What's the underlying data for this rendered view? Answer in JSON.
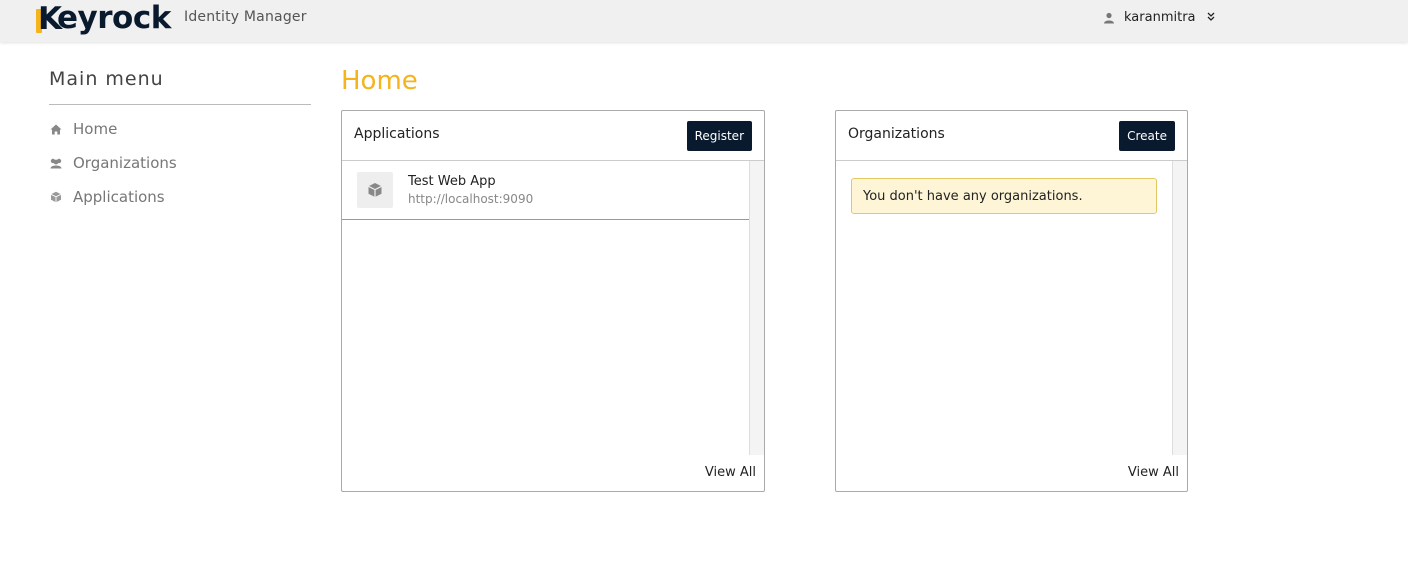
{
  "header": {
    "logo_text": "Keyrock",
    "subtitle": "Identity Manager",
    "user_name": "karanmitra",
    "user_icon": "user-icon",
    "dropdown_icon": "double-chevron-down-icon",
    "brand_color": "#f5b31c",
    "dark_color": "#0a1a2e"
  },
  "sidebar": {
    "title": "Main menu",
    "items": [
      {
        "label": "Home",
        "icon": "home-icon"
      },
      {
        "label": "Organizations",
        "icon": "users-icon"
      },
      {
        "label": "Applications",
        "icon": "cube-icon"
      }
    ]
  },
  "main": {
    "title": "Home",
    "applications": {
      "title": "Applications",
      "button": "Register",
      "items": [
        {
          "name": "Test Web App",
          "url": "http://localhost:9090",
          "icon": "cube-icon"
        }
      ],
      "view_all": "View All"
    },
    "organizations": {
      "title": "Organizations",
      "button": "Create",
      "empty_message": "You don't have any organizations.",
      "view_all": "View All"
    }
  }
}
